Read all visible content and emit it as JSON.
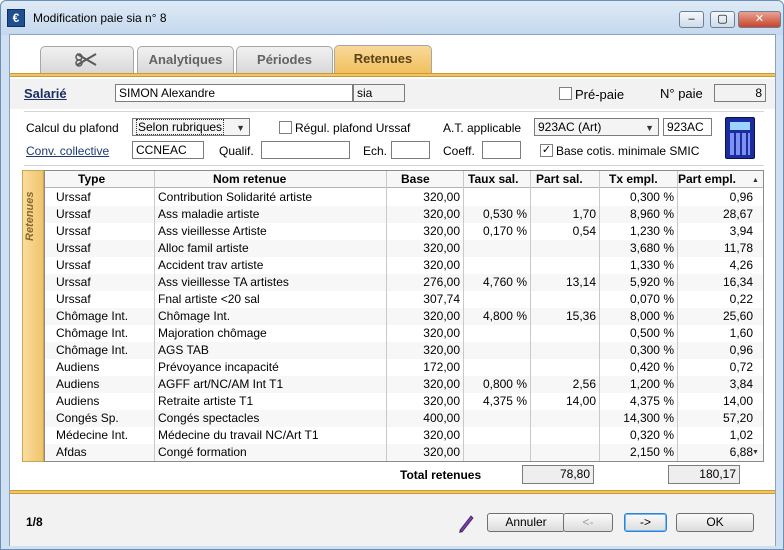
{
  "window": {
    "title": "Modification paie sia n° 8",
    "controls": {
      "minimize": "–",
      "maximize": "▢",
      "close": "✕"
    }
  },
  "tabs": [
    {
      "label": ""
    },
    {
      "label": "Analytiques"
    },
    {
      "label": "Périodes"
    },
    {
      "label": "Retenues"
    }
  ],
  "header": {
    "salarie_label": "Salarié",
    "salarie_name": "SIMON Alexandre",
    "salarie_code": "sia",
    "prepaie_label": "Pré-paie",
    "no_paie_label": "N° paie",
    "no_paie_value": "8"
  },
  "options": {
    "calcul_label": "Calcul du plafond",
    "calcul_value": "Selon rubriques",
    "regul_label": "Régul. plafond Urssaf",
    "at_label": "A.T. applicable",
    "at_value": "923AC (Art)",
    "at_code": "923AC",
    "conv_label": "Conv. collective",
    "conv_value": "CCNEAC",
    "qualif_label": "Qualif.",
    "qualif_value": "",
    "ech_label": "Ech.",
    "ech_value": "",
    "coeff_label": "Coeff.",
    "coeff_value": "",
    "smic_label": "Base cotis. minimale SMIC"
  },
  "sidebar_label": "Retenues",
  "table": {
    "headers": [
      "Type",
      "Nom retenue",
      "Base",
      "Taux sal.",
      "Part sal.",
      "Tx empl.",
      "Part empl."
    ],
    "rows": [
      [
        "Urssaf",
        "Contribution Solidarité artiste",
        "320,00",
        "",
        "",
        "0,300 %",
        "0,96"
      ],
      [
        "Urssaf",
        "Ass maladie artiste",
        "320,00",
        "0,530 %",
        "1,70",
        "8,960 %",
        "28,67"
      ],
      [
        "Urssaf",
        "Ass vieillesse Artiste",
        "320,00",
        "0,170 %",
        "0,54",
        "1,230 %",
        "3,94"
      ],
      [
        "Urssaf",
        "Alloc famil artiste",
        "320,00",
        "",
        "",
        "3,680 %",
        "11,78"
      ],
      [
        "Urssaf",
        "Accident trav artiste",
        "320,00",
        "",
        "",
        "1,330 %",
        "4,26"
      ],
      [
        "Urssaf",
        "Ass vieillesse TA artistes",
        "276,00",
        "4,760 %",
        "13,14",
        "5,920 %",
        "16,34"
      ],
      [
        "Urssaf",
        "Fnal artiste <20 sal",
        "307,74",
        "",
        "",
        "0,070 %",
        "0,22"
      ],
      [
        "Chômage Int.",
        "Chômage Int.",
        "320,00",
        "4,800 %",
        "15,36",
        "8,000 %",
        "25,60"
      ],
      [
        "Chômage Int.",
        "Majoration chômage",
        "320,00",
        "",
        "",
        "0,500 %",
        "1,60"
      ],
      [
        "Chômage Int.",
        "AGS TAB",
        "320,00",
        "",
        "",
        "0,300 %",
        "0,96"
      ],
      [
        "Audiens",
        "Prévoyance incapacité",
        "172,00",
        "",
        "",
        "0,420 %",
        "0,72"
      ],
      [
        "Audiens",
        "AGFF art/NC/AM Int T1",
        "320,00",
        "0,800 %",
        "2,56",
        "1,200 %",
        "3,84"
      ],
      [
        "Audiens",
        "Retraite artiste T1",
        "320,00",
        "4,375 %",
        "14,00",
        "4,375 %",
        "14,00"
      ],
      [
        "Congés Sp.",
        "Congés spectacles",
        "400,00",
        "",
        "",
        "14,300 %",
        "57,20"
      ],
      [
        "Médecine Int.",
        "Médecine du travail NC/Art T1",
        "320,00",
        "",
        "",
        "0,320 %",
        "1,02"
      ],
      [
        "Afdas",
        "Congé formation",
        "320,00",
        "",
        "",
        "2,150 %",
        "6,88"
      ]
    ]
  },
  "totals": {
    "label": "Total retenues",
    "part_sal": "78,80",
    "part_empl": "180,17"
  },
  "footer": {
    "page": "1/8",
    "cancel": "Annuler",
    "prev": "<-",
    "next": "->",
    "ok": "OK"
  }
}
